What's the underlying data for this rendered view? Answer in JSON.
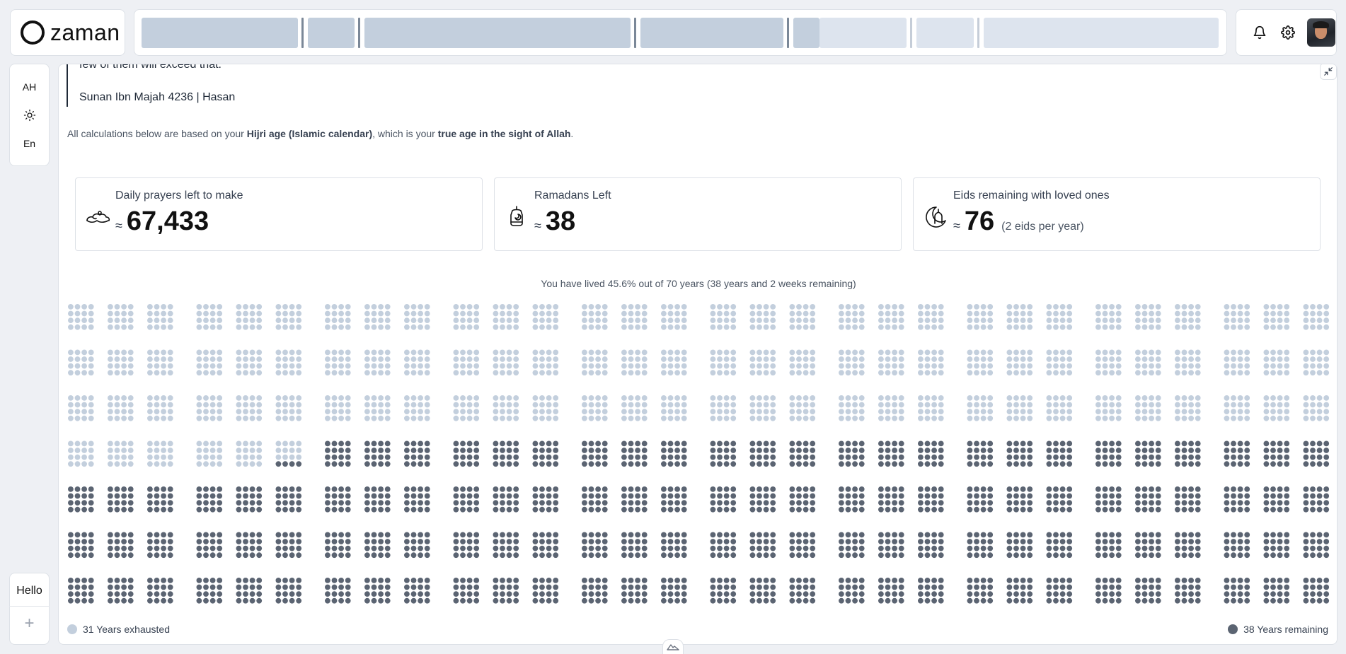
{
  "app": {
    "logo_text": "zaman"
  },
  "sidebar": {
    "calendar_toggle": "AH",
    "language": "En",
    "profile_label": "Hello",
    "add_symbol": "+"
  },
  "hadith": {
    "text_fragment": "few of them will exceed that.\"",
    "source": "Sunan Ibn Majah 4236 | Hasan"
  },
  "calc_note": {
    "prefix": "All calculations below are based on your ",
    "bold1": "Hijri age (Islamic calendar)",
    "middle": ", which is your ",
    "bold2": "true age in the sight of Allah",
    "suffix": "."
  },
  "stats": [
    {
      "title": "Daily prayers left to make",
      "approx": "≈",
      "value": "67,433",
      "note": "",
      "icon": "prayer-mat-icon"
    },
    {
      "title": "Ramadans Left",
      "approx": "≈",
      "value": "38",
      "note": "",
      "icon": "lantern-icon"
    },
    {
      "title": "Eids remaining with loved ones",
      "approx": "≈",
      "value": "76",
      "note": "(2 eids per year)",
      "icon": "crescent-mosque-icon"
    }
  ],
  "life": {
    "summary": "You have lived 45.6% out of 70 years (38 years and 2 weeks remaining)",
    "years_total": 70,
    "years_exhausted": 31,
    "months_per_year": 12,
    "lived_fraction": 0.456
  },
  "legend": {
    "exhausted_label": "31 Years exhausted",
    "remaining_label": "38 Years remaining"
  },
  "colors": {
    "lived_dot": "#c3cfdd",
    "remaining_dot": "#5b6472",
    "nav_active": "#c3cfdd",
    "nav_inactive": "#dde4ee"
  }
}
